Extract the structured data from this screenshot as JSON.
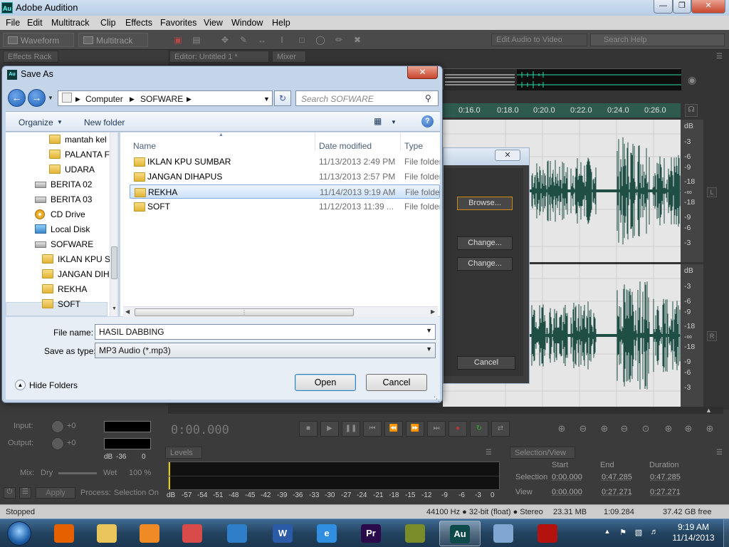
{
  "app": {
    "title": "Adobe Audition",
    "logo": "Au",
    "menu": [
      "File",
      "Edit",
      "Multitrack",
      "Clip",
      "Effects",
      "Favorites",
      "View",
      "Window",
      "Help"
    ],
    "toolbar": {
      "waveform": "Waveform",
      "multitrack": "Multitrack",
      "edit_video": "Edit Audio to Video",
      "search_placeholder": "Search Help"
    },
    "panels": {
      "effects_rack": "Effects Rack",
      "editor_tab": "Editor: Untitled 1 *",
      "mixer_tab": "Mixer",
      "levels": "Levels",
      "selection_view": "Selection/View"
    },
    "timeline_ticks": [
      "0:16.0",
      "0:18.0",
      "0:20.0",
      "0:22.0",
      "0:24.0",
      "0:26.0"
    ],
    "db_labels_top": [
      "dB",
      "-3",
      "-6",
      "-9",
      "-18",
      "-∞",
      "-18",
      "-9",
      "-6",
      "-3"
    ],
    "db_labels_bottom": [
      "dB",
      "-3",
      "-6",
      "-9",
      "-18",
      "-∞",
      "-18",
      "-9",
      "-6",
      "-3"
    ],
    "channel_left": "L",
    "channel_right": "R",
    "bg_dialog": {
      "browse": "Browse...",
      "change1": "Change...",
      "change2": "Change...",
      "cancel": "Cancel"
    },
    "transport": {
      "time": "0:00.000"
    },
    "rack": {
      "input_label": "Input:",
      "input_value": "+0",
      "output_label": "Output:",
      "output_value": "+0",
      "meter_scale": [
        "dB",
        "-36",
        "0"
      ],
      "mix_label": "Mix:",
      "mix_dry": "Dry",
      "mix_wet": "Wet",
      "mix_value": "100 %",
      "apply": "Apply",
      "process_label": "Process:",
      "process_value": "Selection On"
    },
    "levels_scale": [
      "dB",
      "-57",
      "-54",
      "-51",
      "-48",
      "-45",
      "-42",
      "-39",
      "-36",
      "-33",
      "-30",
      "-27",
      "-24",
      "-21",
      "-18",
      "-15",
      "-12",
      "-9",
      "-6",
      "-3",
      "0"
    ],
    "selection_view": {
      "headers": [
        "Start",
        "End",
        "Duration"
      ],
      "selection_label": "Selection",
      "selection": [
        "0:00.000",
        "0:47.285",
        "0:47.285"
      ],
      "view_label": "View",
      "view": [
        "0:00.000",
        "0:27.271",
        "0:27.271"
      ]
    },
    "status": {
      "left": "Stopped",
      "format": "44100 Hz ● 32-bit (float) ● Stereo",
      "size": "23.31 MB",
      "duration": "1:09.284",
      "free": "37.42 GB free"
    }
  },
  "dialog": {
    "title": "Save As",
    "breadcrumb": [
      "Computer",
      "SOFWARE"
    ],
    "search_placeholder": "Search SOFWARE",
    "organize": "Organize",
    "new_folder": "New folder",
    "nav_items": [
      {
        "label": "mantah kel",
        "icon": "folder-icon"
      },
      {
        "label": "PALANTA F",
        "icon": "folder-icon"
      },
      {
        "label": "UDARA",
        "icon": "folder-icon"
      },
      {
        "label": "BERITA 02",
        "icon": "drive-icon"
      },
      {
        "label": "BERITA 03",
        "icon": "drive-icon"
      },
      {
        "label": "CD Drive",
        "icon": "cd-drive-icon"
      },
      {
        "label": "Local Disk",
        "icon": "local-disk-icon"
      },
      {
        "label": "SOFWARE",
        "icon": "drive-icon"
      },
      {
        "label": "IKLAN KPU SU",
        "icon": "folder-icon"
      },
      {
        "label": "JANGAN DIH",
        "icon": "folder-icon"
      },
      {
        "label": "REKHA",
        "icon": "folder-icon"
      },
      {
        "label": "SOFT",
        "icon": "folder-icon"
      }
    ],
    "columns": [
      "Name",
      "Date modified",
      "Type"
    ],
    "files": [
      {
        "name": "IKLAN KPU SUMBAR",
        "date": "11/13/2013 2:49 PM",
        "type": "File folder"
      },
      {
        "name": "JANGAN DIHAPUS",
        "date": "11/13/2013 2:57 PM",
        "type": "File folder"
      },
      {
        "name": "REKHA",
        "date": "11/14/2013 9:19 AM",
        "type": "File folder"
      },
      {
        "name": "SOFT",
        "date": "11/12/2013 11:39 ...",
        "type": "File folder"
      }
    ],
    "selected_file": "REKHA",
    "file_name_label": "File name:",
    "file_name_value": "HASIL DABBING",
    "save_type_label": "Save as type:",
    "save_type_value": "MP3 Audio (*.mp3)",
    "hide_folders": "Hide Folders",
    "open": "Open",
    "cancel": "Cancel"
  },
  "taskbar": {
    "apps": [
      {
        "name": "firefox-icon",
        "label": "",
        "color": "#e66000"
      },
      {
        "name": "explorer-icon",
        "label": "",
        "color": "#e8c45a"
      },
      {
        "name": "media-player-icon",
        "label": "",
        "color": "#f08a24"
      },
      {
        "name": "paint-icon",
        "label": "",
        "color": "#d94b4b"
      },
      {
        "name": "feather-icon",
        "label": "",
        "color": "#2f7ec9"
      },
      {
        "name": "word-icon",
        "label": "W",
        "color": "#2b5aa8"
      },
      {
        "name": "internet-explorer-icon",
        "label": "e",
        "color": "#2f8ee0"
      },
      {
        "name": "premiere-icon",
        "label": "Pr",
        "color": "#2a0a4a"
      },
      {
        "name": "winamp-icon",
        "label": "",
        "color": "#7a8b2a"
      },
      {
        "name": "audition-icon",
        "label": "Au",
        "color": "#0d4a4a"
      },
      {
        "name": "paint-palette-icon",
        "label": "",
        "color": "#7fa6d1"
      },
      {
        "name": "adobe-reader-icon",
        "label": "",
        "color": "#b3120f"
      }
    ],
    "time": "9:19 AM",
    "date": "11/14/2013"
  }
}
